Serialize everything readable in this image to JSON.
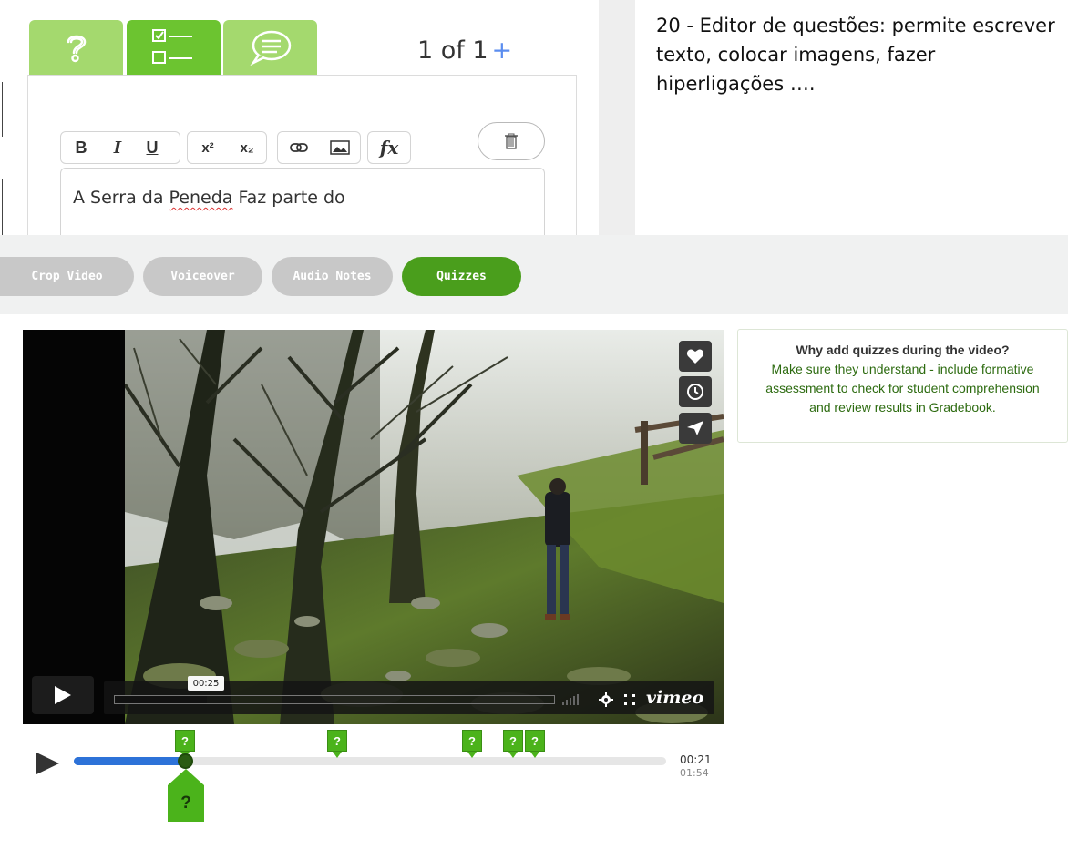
{
  "editor": {
    "tabs": [
      {
        "icon": "question-icon",
        "active": false
      },
      {
        "icon": "checklist-icon",
        "active": true
      },
      {
        "icon": "chat-bubble-icon",
        "active": false
      }
    ],
    "page_counter": "1 of 1",
    "page_add": "+",
    "toolbar": {
      "bold": "B",
      "italic": "I",
      "underline": "U",
      "superscript": "x²",
      "subscript": "x₂",
      "link_icon": "link-icon",
      "image_icon": "image-icon",
      "formula": "fx"
    },
    "delete_icon": "trash-icon",
    "question_text_before": "A Serra da ",
    "question_text_misspelled": "Peneda",
    "question_text_after": " Faz parte do"
  },
  "caption": "20 - Editor de questões: permite escrever texto, colocar imagens, fazer hiperligações ….",
  "modes": {
    "crop": "Crop Video",
    "voiceover": "Voiceover",
    "audio_notes": "Audio Notes",
    "quizzes": "Quizzes",
    "active": "Quizzes"
  },
  "player": {
    "tooltip_time": "00:25",
    "brand": "vimeo",
    "progress_fraction": 0.21,
    "side_buttons": [
      "heart-icon",
      "clock-icon",
      "send-icon"
    ]
  },
  "info": {
    "title": "Why add quizzes during the video?",
    "body_line1": "Make sure they understand - include formative",
    "body_line2": "assessment to check for student comprehension",
    "body_line3": "and review results in Gradebook."
  },
  "timeline": {
    "current_time": "00:21",
    "total_time": "01:54",
    "marker_label": "?",
    "progress_fraction": 0.185
  },
  "colors": {
    "tab_green": "#a4d96e",
    "tab_active": "#6cc430",
    "quiz_active": "#4a9e1c",
    "marker_green": "#4bb31b",
    "timeline_blue": "#2d72d8"
  }
}
